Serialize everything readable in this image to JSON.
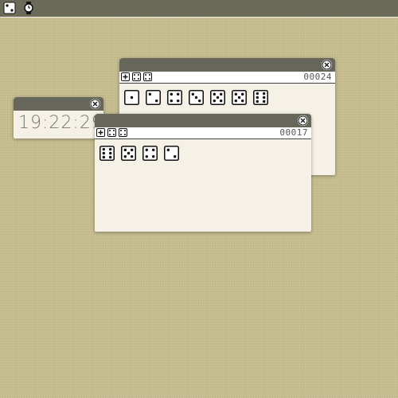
{
  "taskbar": {
    "icons": [
      "dice-icon",
      "watch-icon"
    ]
  },
  "windows": {
    "clock": {
      "time": "19:22:29"
    },
    "dice_back": {
      "counter": "00024",
      "toolbar_icons": [
        "add-die-icon",
        "reroll-icon",
        "remove-die-icon"
      ],
      "dice": [
        1,
        2,
        4,
        3,
        5,
        5,
        6
      ]
    },
    "dice_front": {
      "counter": "00017",
      "toolbar_icons": [
        "add-die-icon",
        "reroll-icon",
        "remove-die-icon"
      ],
      "dice": [
        6,
        5,
        4,
        2
      ]
    }
  },
  "colors": {
    "desktop": "#c6bd8f",
    "titlebar": "#67665a",
    "window_body": "#f6f1e6"
  }
}
